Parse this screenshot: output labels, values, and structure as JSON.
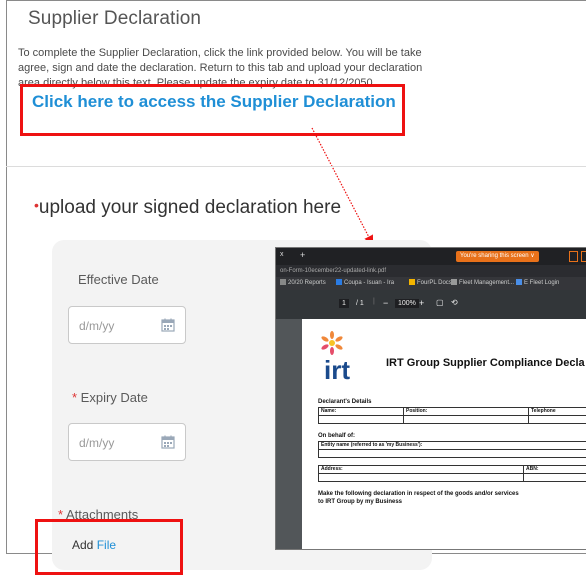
{
  "page": {
    "title": "Supplier Declaration",
    "intro_lines": [
      "To complete the Supplier Declaration, click the link provided below.  You will be take",
      "agree, sign and date the declaration.  Return to this tab and upload your declaration",
      "area directly below this text.  Please update the expiry date to 31/12/2050."
    ],
    "access_link": "Click here to access the Supplier Declaration",
    "upload_heading": "upload your signed declaration here"
  },
  "form": {
    "effective_date_label": "Effective Date",
    "effective_date_placeholder": "d/m/yy",
    "expiry_date_label": "Expiry Date",
    "expiry_date_placeholder": "d/m/yy",
    "attachments_label": "Attachments",
    "add_label": "Add",
    "file_label": "File"
  },
  "pdf_window": {
    "tab_close": "x",
    "tab_new": "+",
    "sharing_notice": "You're sharing this screen ∨",
    "url": "on-Form-10ecember22-updated-link.pdf",
    "bookmarks": [
      "20/20 Reports",
      "Coupa - Isuan - Ira",
      "FourPL Docs",
      "Fleet Management...",
      "E Fleet Login"
    ],
    "page_current": "1",
    "page_total": "/ 1",
    "zoom": "100%",
    "doc": {
      "logo_text": "irt",
      "title": "IRT Group Supplier Compliance Decla",
      "declarant_heading": "Declarant's Details",
      "name_label": "Name:",
      "position_label": "Position:",
      "telephone_label": "Telephone",
      "behalf_heading": "On behalf of:",
      "entity_label": "Entity name (referred to as 'my Business'):",
      "address_label": "Address:",
      "abn_label": "ABN:",
      "declaration_line1": "Make the following declaration in respect of the goods and/or services",
      "declaration_line2": "to IRT Group by my Business"
    }
  },
  "colors": {
    "link": "#1f8fd6",
    "highlight_box": "#ee1111",
    "required_asterisk": "#dd3333",
    "share_orange": "#e8711a"
  }
}
